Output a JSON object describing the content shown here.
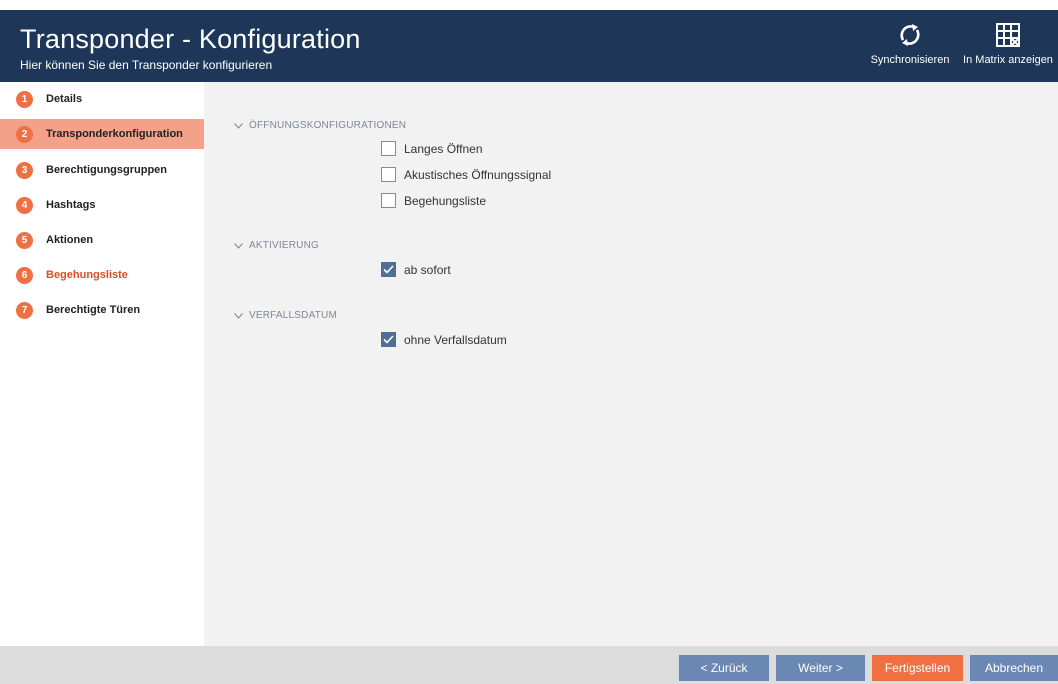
{
  "header": {
    "title": "Transponder - Konfiguration",
    "subtitle": "Hier können Sie den Transponder konfigurieren",
    "actions": [
      {
        "label": "Synchronisieren",
        "icon": "sync-icon"
      },
      {
        "label": "In Matrix anzeigen",
        "icon": "matrix-grid-icon"
      }
    ]
  },
  "sidebar": {
    "steps": [
      {
        "number": "1",
        "label": "Details",
        "state": "normal"
      },
      {
        "number": "2",
        "label": "Transponderkonfiguration",
        "state": "active"
      },
      {
        "number": "3",
        "label": "Berechtigungsgruppen",
        "state": "normal"
      },
      {
        "number": "4",
        "label": "Hashtags",
        "state": "normal"
      },
      {
        "number": "5",
        "label": "Aktionen",
        "state": "normal"
      },
      {
        "number": "6",
        "label": "Begehungsliste",
        "state": "link"
      },
      {
        "number": "7",
        "label": "Berechtigte Türen",
        "state": "normal"
      }
    ]
  },
  "main": {
    "sections": [
      {
        "title": "ÖFFNUNGSKONFIGURATIONEN",
        "options": [
          {
            "label": "Langes Öffnen",
            "checked": false
          },
          {
            "label": "Akustisches Öffnungssignal",
            "checked": false
          },
          {
            "label": "Begehungsliste",
            "checked": false
          }
        ]
      },
      {
        "title": "AKTIVIERUNG",
        "options": [
          {
            "label": "ab sofort",
            "checked": true
          }
        ]
      },
      {
        "title": "VERFALLSDATUM",
        "options": [
          {
            "label": "ohne Verfallsdatum",
            "checked": true
          }
        ]
      }
    ]
  },
  "footer": {
    "back": "< Zurück",
    "next": "Weiter >",
    "finish": "Fertigstellen",
    "cancel": "Abbrechen"
  },
  "colors": {
    "header_bg": "#1e3658",
    "accent": "#f07043",
    "active_step_bg": "#f3a289",
    "button_blue": "#6b87b3",
    "checkbox_checked": "#4f6f97"
  }
}
